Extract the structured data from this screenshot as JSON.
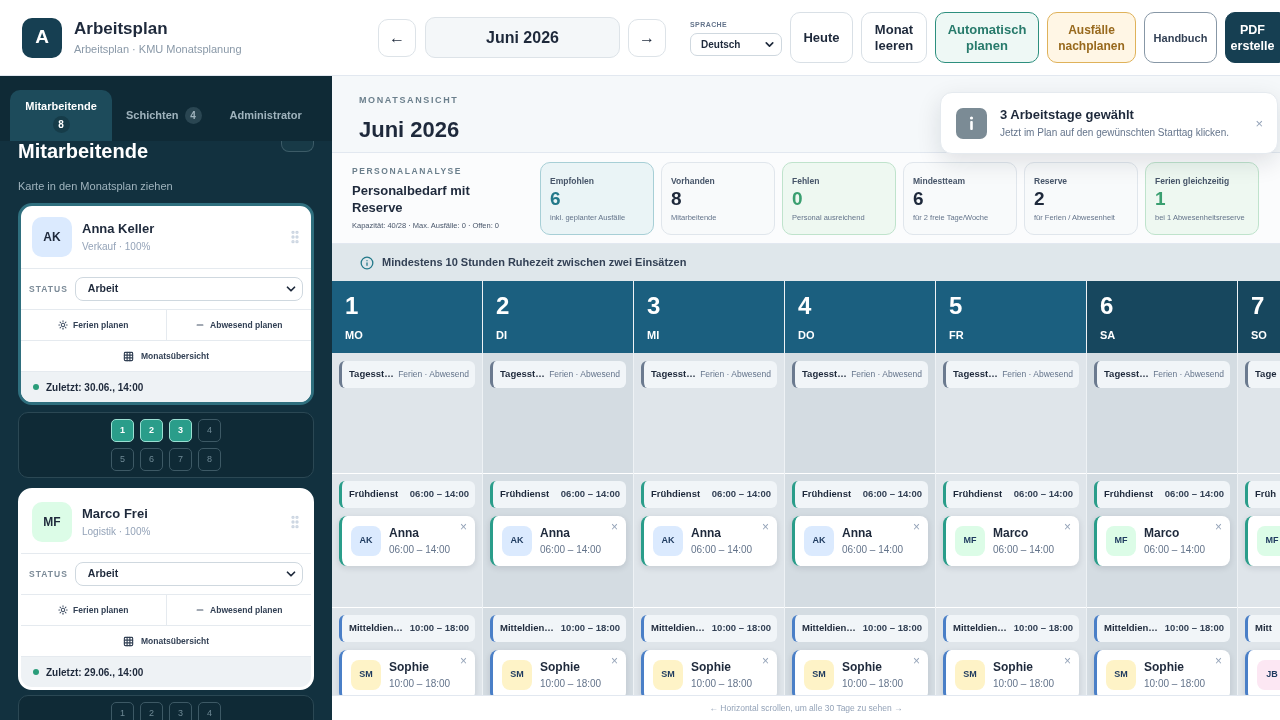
{
  "header": {
    "logo": "A",
    "title": "Arbeitsplan",
    "subtitle": "Arbeitsplan · KMU Monatsplanung",
    "prev": "←",
    "month": "Juni 2026",
    "next": "→",
    "language": {
      "label": "SPRACHE",
      "value": "Deutsch"
    },
    "buttons": [
      {
        "label": "Heute",
        "kind": "default"
      },
      {
        "label": "Monat leeren",
        "kind": "default"
      },
      {
        "label": "Automatisch planen",
        "kind": "soft"
      },
      {
        "label": "Ausfälle nachplanen",
        "kind": "warning"
      },
      {
        "label": "Handbuch",
        "kind": "outline"
      },
      {
        "label": "PDF erstelle",
        "kind": "dark"
      }
    ]
  },
  "sidebar": {
    "tabs": [
      {
        "label": "Mitarbeitende",
        "count": "8",
        "selected": true
      },
      {
        "label": "Schichten",
        "count": "4",
        "selected": false
      },
      {
        "label": "Administrator",
        "selected": false
      }
    ],
    "heading": "Mitarbeitende",
    "hint": "Karte in den Monatsplan ziehen",
    "employees": [
      {
        "initials": "AK",
        "name": "Anna Keller",
        "role": "Verkauf · 100%",
        "color": "#dbeafe",
        "selected": true,
        "status_label": "STATUS",
        "status": "Arbeit",
        "actions": [
          {
            "kind": "vacation",
            "label": "Ferien planen"
          },
          {
            "kind": "absence",
            "label": "Abwesend planen"
          }
        ],
        "overview": "Monatsübersicht",
        "last_seen": "Zuletzt: 30.06., 14:00",
        "days": [
          {
            "label": "1",
            "selected": true
          },
          {
            "label": "2",
            "selected": true
          },
          {
            "label": "3",
            "selected": true
          },
          {
            "label": "4",
            "selected": false
          },
          {
            "label": "5",
            "selected": false
          },
          {
            "label": "6",
            "selected": false
          },
          {
            "label": "7",
            "selected": false
          },
          {
            "label": "8",
            "selected": false
          }
        ]
      },
      {
        "initials": "MF",
        "name": "Marco Frei",
        "role": "Logistik · 100%",
        "color": "#dcfce7",
        "selected": false,
        "status_label": "STATUS",
        "status": "Arbeit",
        "actions": [
          {
            "kind": "vacation",
            "label": "Ferien planen"
          },
          {
            "kind": "absence",
            "label": "Abwesend planen"
          }
        ],
        "overview": "Monatsübersicht",
        "last_seen": "Zuletzt: 29.06., 14:00",
        "days": [
          {
            "label": "1",
            "selected": false
          },
          {
            "label": "2",
            "selected": false
          },
          {
            "label": "3",
            "selected": false
          },
          {
            "label": "4",
            "selected": false
          }
        ]
      }
    ]
  },
  "main": {
    "view_label": "MONATSANSICHT",
    "title": "Juni 2026",
    "analysis": {
      "label": "PERSONALANALYSE",
      "title": "Personalbedarf mit Reserve",
      "summary": "Kapazität: 40/28 · Max. Ausfälle: 0 · Offen: 0",
      "stats": [
        {
          "label": "Empfohlen",
          "value": "6",
          "note": "inkl. geplanter Ausfälle",
          "kind": "accent"
        },
        {
          "label": "Vorhanden",
          "value": "8",
          "note": "Mitarbeitende",
          "kind": "neutral"
        },
        {
          "label": "Fehlen",
          "value": "0",
          "note": "Personal ausreichend",
          "kind": "success"
        },
        {
          "label": "Mindestteam",
          "value": "6",
          "note": "für 2 freie Tage/Woche",
          "kind": "neutral"
        },
        {
          "label": "Reserve",
          "value": "2",
          "note": "für Ferien / Abwesenheit",
          "kind": "neutral"
        },
        {
          "label": "Ferien gleichzeitig",
          "value": "1",
          "note": "bei 1 Abwesenheitsreserve",
          "kind": "success"
        }
      ]
    },
    "notice": "Mindestens 10 Stunden Ruhezeit zwischen zwei Einsätzen",
    "calendar": {
      "days": [
        {
          "number": "1",
          "weekday": "MO",
          "weekend": false,
          "slots": [
            {
              "kind": "status",
              "label": "Tagesst…",
              "detail": "Ferien · Abwesend"
            },
            {
              "kind": "early",
              "label": "Frühdienst",
              "time": "06:00 – 14:00",
              "assignments": [
                {
                  "initials": "AK",
                  "name": "Anna",
                  "time": "06:00 – 14:00",
                  "color": "#dbeafe",
                  "remove": "×"
                }
              ]
            },
            {
              "kind": "mid",
              "label": "Mitteldien…",
              "time": "10:00 – 18:00",
              "assignments": [
                {
                  "initials": "SM",
                  "name": "Sophie",
                  "time": "10:00 – 18:00",
                  "color": "#fef3c7",
                  "remove": "×"
                }
              ]
            }
          ]
        },
        {
          "number": "2",
          "weekday": "DI",
          "weekend": false,
          "slots": [
            {
              "kind": "status",
              "label": "Tagesst…",
              "detail": "Ferien · Abwesend"
            },
            {
              "kind": "early",
              "label": "Frühdienst",
              "time": "06:00 – 14:00",
              "assignments": [
                {
                  "initials": "AK",
                  "name": "Anna",
                  "time": "06:00 – 14:00",
                  "color": "#dbeafe",
                  "remove": "×"
                }
              ]
            },
            {
              "kind": "mid",
              "label": "Mitteldien…",
              "time": "10:00 – 18:00",
              "assignments": [
                {
                  "initials": "SM",
                  "name": "Sophie",
                  "time": "10:00 – 18:00",
                  "color": "#fef3c7",
                  "remove": "×"
                }
              ]
            }
          ]
        },
        {
          "number": "3",
          "weekday": "MI",
          "weekend": false,
          "slots": [
            {
              "kind": "status",
              "label": "Tagesst…",
              "detail": "Ferien · Abwesend"
            },
            {
              "kind": "early",
              "label": "Frühdienst",
              "time": "06:00 – 14:00",
              "assignments": [
                {
                  "initials": "AK",
                  "name": "Anna",
                  "time": "06:00 – 14:00",
                  "color": "#dbeafe",
                  "remove": "×"
                }
              ]
            },
            {
              "kind": "mid",
              "label": "Mitteldien…",
              "time": "10:00 – 18:00",
              "assignments": [
                {
                  "initials": "SM",
                  "name": "Sophie",
                  "time": "10:00 – 18:00",
                  "color": "#fef3c7",
                  "remove": "×"
                }
              ]
            }
          ]
        },
        {
          "number": "4",
          "weekday": "DO",
          "weekend": false,
          "slots": [
            {
              "kind": "status",
              "label": "Tagesst…",
              "detail": "Ferien · Abwesend"
            },
            {
              "kind": "early",
              "label": "Frühdienst",
              "time": "06:00 – 14:00",
              "assignments": [
                {
                  "initials": "AK",
                  "name": "Anna",
                  "time": "06:00 – 14:00",
                  "color": "#dbeafe",
                  "remove": "×"
                }
              ]
            },
            {
              "kind": "mid",
              "label": "Mitteldien…",
              "time": "10:00 – 18:00",
              "assignments": [
                {
                  "initials": "SM",
                  "name": "Sophie",
                  "time": "10:00 – 18:00",
                  "color": "#fef3c7",
                  "remove": "×"
                }
              ]
            }
          ]
        },
        {
          "number": "5",
          "weekday": "FR",
          "weekend": false,
          "slots": [
            {
              "kind": "status",
              "label": "Tagesst…",
              "detail": "Ferien · Abwesend"
            },
            {
              "kind": "early",
              "label": "Frühdienst",
              "time": "06:00 – 14:00",
              "assignments": [
                {
                  "initials": "MF",
                  "name": "Marco",
                  "time": "06:00 – 14:00",
                  "color": "#dcfce7",
                  "remove": "×"
                }
              ]
            },
            {
              "kind": "mid",
              "label": "Mitteldien…",
              "time": "10:00 – 18:00",
              "assignments": [
                {
                  "initials": "SM",
                  "name": "Sophie",
                  "time": "10:00 – 18:00",
                  "color": "#fef3c7",
                  "remove": "×"
                }
              ]
            }
          ]
        },
        {
          "number": "6",
          "weekday": "SA",
          "weekend": true,
          "slots": [
            {
              "kind": "status",
              "label": "Tagesst…",
              "detail": "Ferien · Abwesend"
            },
            {
              "kind": "early",
              "label": "Frühdienst",
              "time": "06:00 – 14:00",
              "assignments": [
                {
                  "initials": "MF",
                  "name": "Marco",
                  "time": "06:00 – 14:00",
                  "color": "#dcfce7",
                  "remove": "×"
                }
              ]
            },
            {
              "kind": "mid",
              "label": "Mitteldien…",
              "time": "10:00 – 18:00",
              "assignments": [
                {
                  "initials": "SM",
                  "name": "Sophie",
                  "time": "10:00 – 18:00",
                  "color": "#fef3c7",
                  "remove": "×"
                }
              ]
            }
          ]
        },
        {
          "number": "7",
          "weekday": "SO",
          "weekend": true,
          "slots": [
            {
              "kind": "status",
              "label": "Tage"
            },
            {
              "kind": "early",
              "label": "Früh",
              "assignments": [
                {
                  "initials": "MF",
                  "color": "#dcfce7"
                }
              ]
            },
            {
              "kind": "mid",
              "label": "Mitt",
              "assignments": [
                {
                  "initials": "JB",
                  "color": "#fce7f3"
                }
              ]
            }
          ]
        }
      ]
    },
    "scroll_hint": "← Horizontal scrollen, um alle 30 Tage zu sehen →"
  },
  "toast": {
    "title": "3 Arbeitstage gewählt",
    "message": "Jetzt im Plan auf den gewünschten Starttag klicken.",
    "close": "×"
  }
}
